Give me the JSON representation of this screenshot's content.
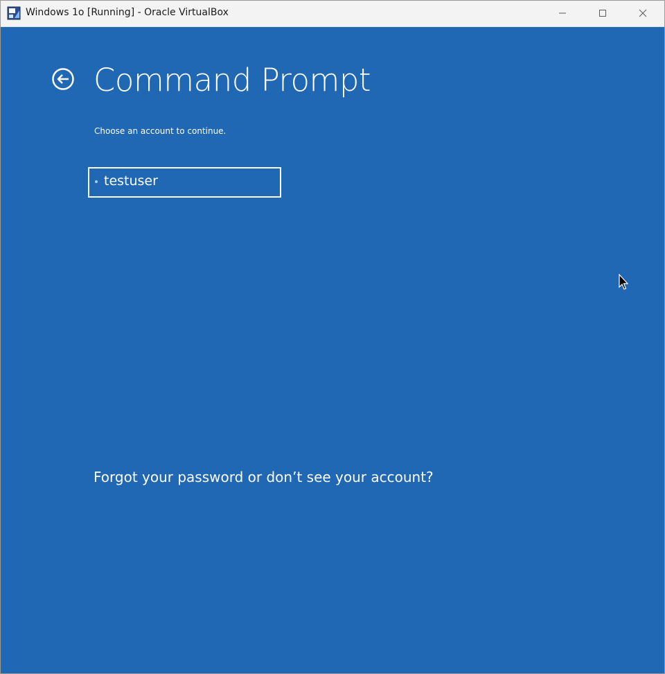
{
  "window": {
    "title": "Windows 1o [Running] - Oracle VirtualBox",
    "icon": "virtualbox-icon",
    "controls": {
      "minimize": "minimize-icon",
      "maximize": "maximize-icon",
      "close": "close-icon"
    }
  },
  "screen": {
    "background_color": "#2067b4",
    "back_icon": "back-arrow-icon",
    "title": "Command Prompt",
    "subtitle": "Choose an account to continue.",
    "accounts": [
      {
        "name": "testuser",
        "selected": true
      }
    ],
    "forgot_link": "Forgot your password or don’t see your account?"
  }
}
